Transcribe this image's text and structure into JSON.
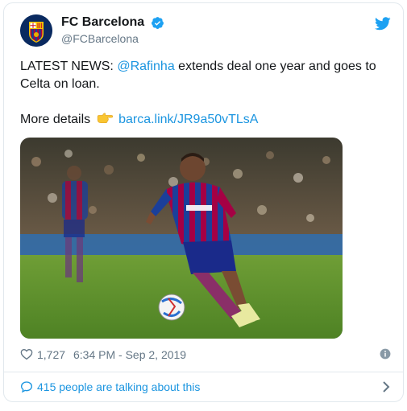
{
  "account": {
    "display_name": "FC Barcelona",
    "handle": "@FCBarcelona",
    "verified": true
  },
  "tweet": {
    "prefix": "LATEST NEWS: ",
    "mention": "@Rafinha",
    "line1_rest": " extends deal one year and goes to",
    "line2": "Celta on loan.",
    "details_label": "More details",
    "details_emoji": "backhand-index-pointing-right",
    "link_text": "barca.link/JR9a50vTLsA"
  },
  "stats": {
    "likes": "1,727",
    "timestamp": "6:34 PM - Sep 2, 2019"
  },
  "footer": {
    "talking_label": "415 people are talking about this"
  },
  "colors": {
    "link": "#1b95e0",
    "text": "#14171a",
    "muted": "#657786",
    "border": "#e1e8ed",
    "verified": "#1da1f2"
  },
  "icons": [
    "club-crest-avatar",
    "verified-badge-icon",
    "twitter-bird-icon",
    "pointing-hand-emoji",
    "heart-icon",
    "info-icon",
    "chat-bubble-icon",
    "chevron-right-icon"
  ]
}
